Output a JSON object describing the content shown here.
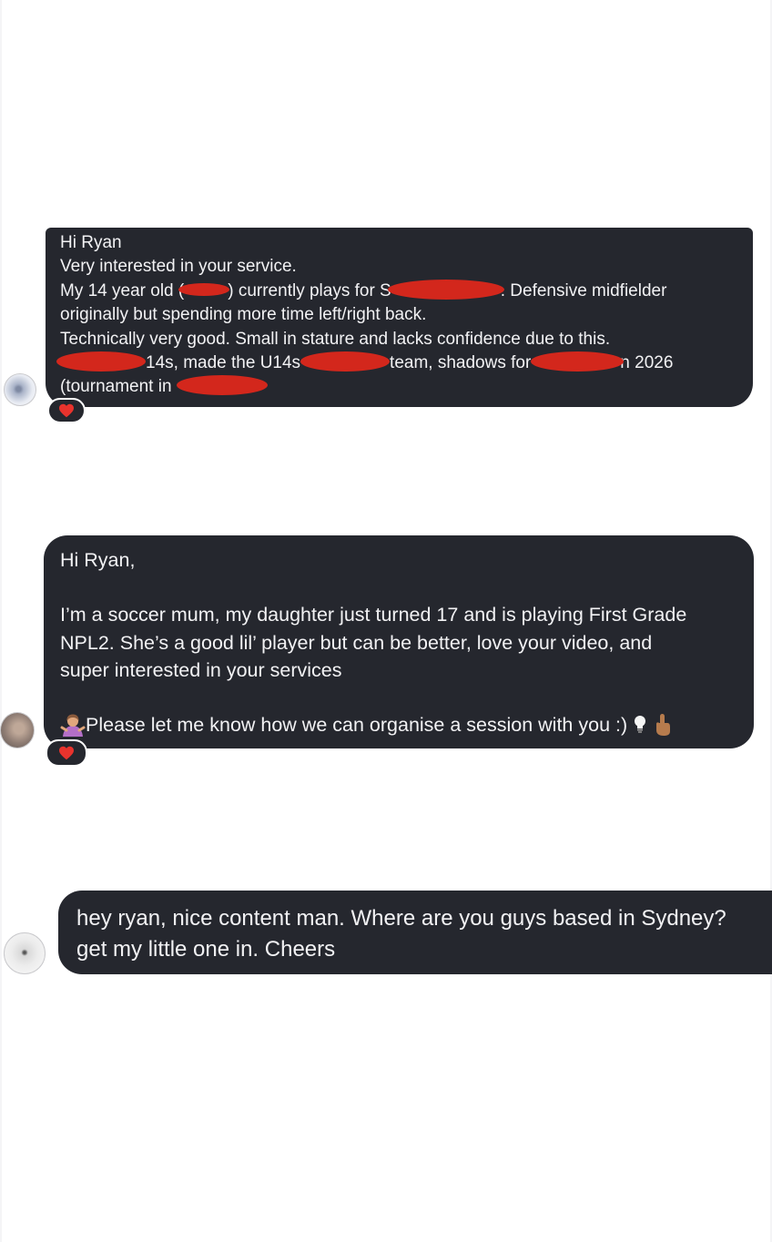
{
  "messages": [
    {
      "id": "m1",
      "reaction": "heart",
      "lines": {
        "l1": "Hi Ryan",
        "l2": "Very interested in your service.",
        "l3a": "My 14 year old (",
        "l3b": ") currently plays for S",
        "l3c": ". Defensive midfielder",
        "l4": "originally but spending more time left/right back.",
        "l5": "Technically very good. Small in stature and lacks confidence due to this.",
        "l6a": "14s, made the U14s",
        "l6b": "team, shadows for",
        "l6c": "n 2026",
        "l7a": "(tournament in"
      }
    },
    {
      "id": "m2",
      "reaction": "heart",
      "lines": {
        "l1": "Hi Ryan,",
        "l2": "I’m a soccer mum, my daughter just turned 17 and is playing First Grade",
        "l3": "NPL2. She’s a good lil’ player but can be better, love your video, and",
        "l4": "super interested in your services",
        "l5": "Please let me know how we can organise a session with you :)"
      }
    },
    {
      "id": "m3",
      "lines": {
        "l1": "hey ryan, nice content man. Where are you guys based in Sydney?",
        "l2": "get my little one in. Cheers"
      }
    }
  ],
  "icons": {
    "reaction": "heart-icon",
    "emoji_1": "person-shrugging-icon",
    "emoji_2": "light-bulb-icon",
    "emoji_3": "hand-pointing-up-icon"
  },
  "colors": {
    "bubble": "#25272e",
    "text": "#f2f2f4",
    "redaction": "#d3271c",
    "heart": "#e8332d",
    "background": "#ffffff"
  }
}
